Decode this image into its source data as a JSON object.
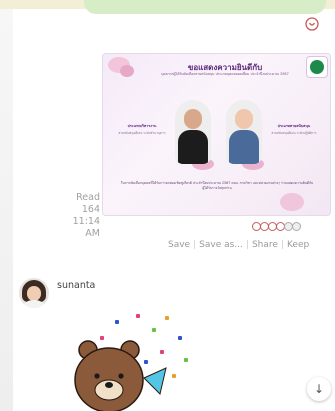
{
  "message": {
    "read_label": "Read 164",
    "time": "11:14 AM",
    "card": {
      "title": "ขอแสดงความยินดีกับ",
      "subtitle": "บุคลากรผู้ได้รับคัดเลือกสายสนับสนุน ประเภทบุคคลยอดเยี่ยม ประจำปีงบประมาณ 2567",
      "person1_title": "ประเภทบริหารงาน",
      "person1_sub": "สายสนับสนุนดีเด่น ระดับชำนาญการ",
      "person2_title": "ประเภทสายสนับสนุน",
      "person2_sub": "สายสนับสนุนดีเด่น ระดับปฏิบัติการ",
      "body": "ในการคัดเลือกบุคคลที่ได้รับการยกย่องเชิดชูเกียรติ ประจำปีงบประมาณ 2567 คณะ ภาควิชา และหน่วยงานต่างๆ ร่วมแสดงความยินดีกับผู้ได้รับรางวัลทุกท่าน"
    },
    "reactions_count": 6
  },
  "actions": {
    "save": "Save",
    "save_as": "Save as...",
    "share": "Share",
    "keep": "Keep"
  },
  "sender": {
    "name": "sunanta"
  },
  "colors": {
    "bubble": "#d7edc7",
    "accent": "#5d2a7b",
    "reaction": "#c75c5c"
  }
}
